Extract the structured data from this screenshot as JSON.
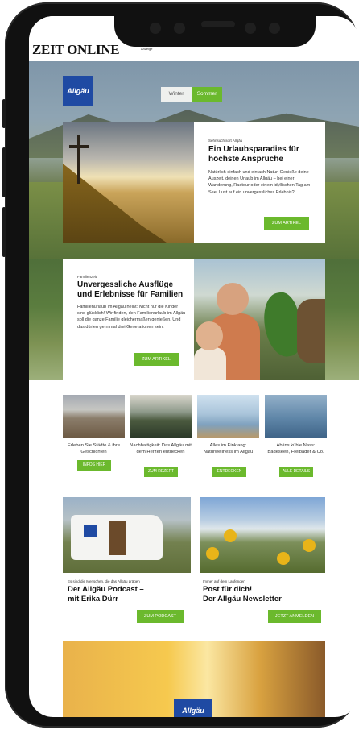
{
  "header": {
    "site_logo": "ZEIT ONLINE",
    "ad_label": "Anzeige"
  },
  "hero": {
    "brand_logo": "Allgäu",
    "season_toggle": {
      "options": [
        "Winter",
        "Sommer"
      ],
      "selected": "Sommer"
    }
  },
  "feature1": {
    "kicker": "Sehnsuchtsort Allgäu",
    "title": "Ein Urlaubsparadies für höchste Ansprüche",
    "text": "Natürlich einfach und einfach Natur. Genieße deine Auszeit, deinen Urlaub im Allgäu – bei einer Wanderung, Radtour oder einem idyllischen Tag am See. Lust auf ein unvergessliches Erlebnis?",
    "button": "ZUM ARTIKEL"
  },
  "feature2": {
    "kicker": "Familienzeit",
    "title": "Unvergessliche Ausflüge und Erlebnisse für Familien",
    "text": "Familienurlaub im Allgäu heißt: Nicht nur die Kinder sind glücklich! Wir finden, den Familienurlaub im Allgäu soll die ganze Familie gleichermaßen genießen. Und das dürfen gern mal drei Generationen sein.",
    "button": "ZUM ARTIKEL"
  },
  "tiles": [
    {
      "text": "Erleben Sie Städte & ihre Geschichten",
      "button": "INFOS HIER"
    },
    {
      "text": "Nachhaltigkeit: Das Allgäu mit dem Herzen entdecken",
      "button": "ZUM REZEPT"
    },
    {
      "text": "Alles im Einklang: Naturwellness im Allgäu",
      "button": "ENTDECKEN"
    },
    {
      "text": "Ab ins kühle Nass: Badeseen, Freibäder & Co.",
      "button": "ALLE DETAILS"
    }
  ],
  "promo_left": {
    "kicker": "Es sind die Menschen, die das Allgäu prägen",
    "title_line1": "Der Allgäu Podcast –",
    "title_line2": "mit Erika Dürr",
    "button": "ZUM PODCAST"
  },
  "promo_right": {
    "kicker": "Immer auf dem Laufenden",
    "title_line1": "Post für dich!",
    "title_line2": "Der Allgäu Newsletter",
    "button": "JETZT ANMELDEN"
  },
  "footer_brand": "Allgäu",
  "colors": {
    "accent_green": "#6bb92d",
    "brand_blue": "#1f4aa3"
  }
}
